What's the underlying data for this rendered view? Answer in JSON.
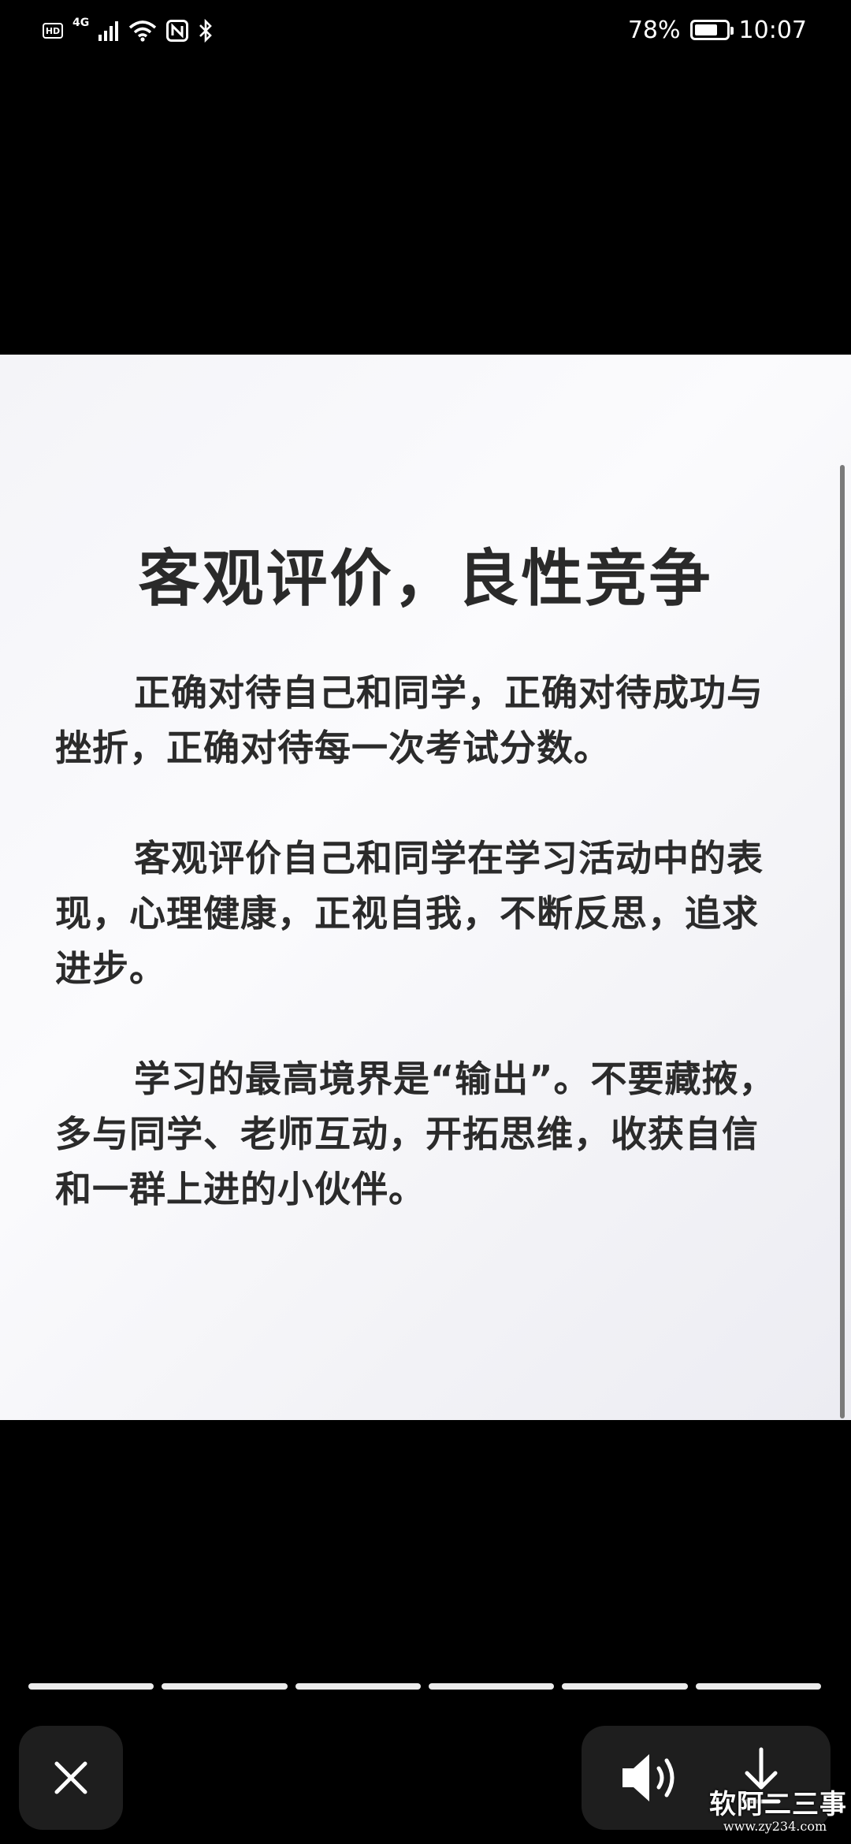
{
  "status_bar": {
    "hd": "HD",
    "network": "4G",
    "battery_percent": "78%",
    "battery_level": 0.78,
    "time": "10:07",
    "icons": [
      "hd-icon",
      "cellular-signal-icon",
      "wifi-icon",
      "nfc-icon",
      "bluetooth-icon",
      "battery-icon"
    ]
  },
  "content": {
    "title": "客观评价，良性竞争",
    "paragraphs": [
      "正确对待自己和同学，正确对待成功与挫折，正确对待每一次考试分数。",
      "客观评价自己和同学在学习活动中的表现，心理健康，正视自我，不断反思，追求进步。",
      "学习的最高境界是“输出”。不要藏掖，多与同学、老师互动，开拓思维，收获自信和一群上进的小伙伴。"
    ]
  },
  "viewer": {
    "segments_total": 6,
    "controls": [
      "close-icon",
      "speaker-icon",
      "download-icon"
    ]
  },
  "watermark": {
    "title": "软阿二三事",
    "url": "www.zy234.com"
  },
  "colors": {
    "background": "#000000",
    "card": "#f6f6f9",
    "text": "#2b2b2b",
    "control_bg": "#1e1e1e"
  }
}
